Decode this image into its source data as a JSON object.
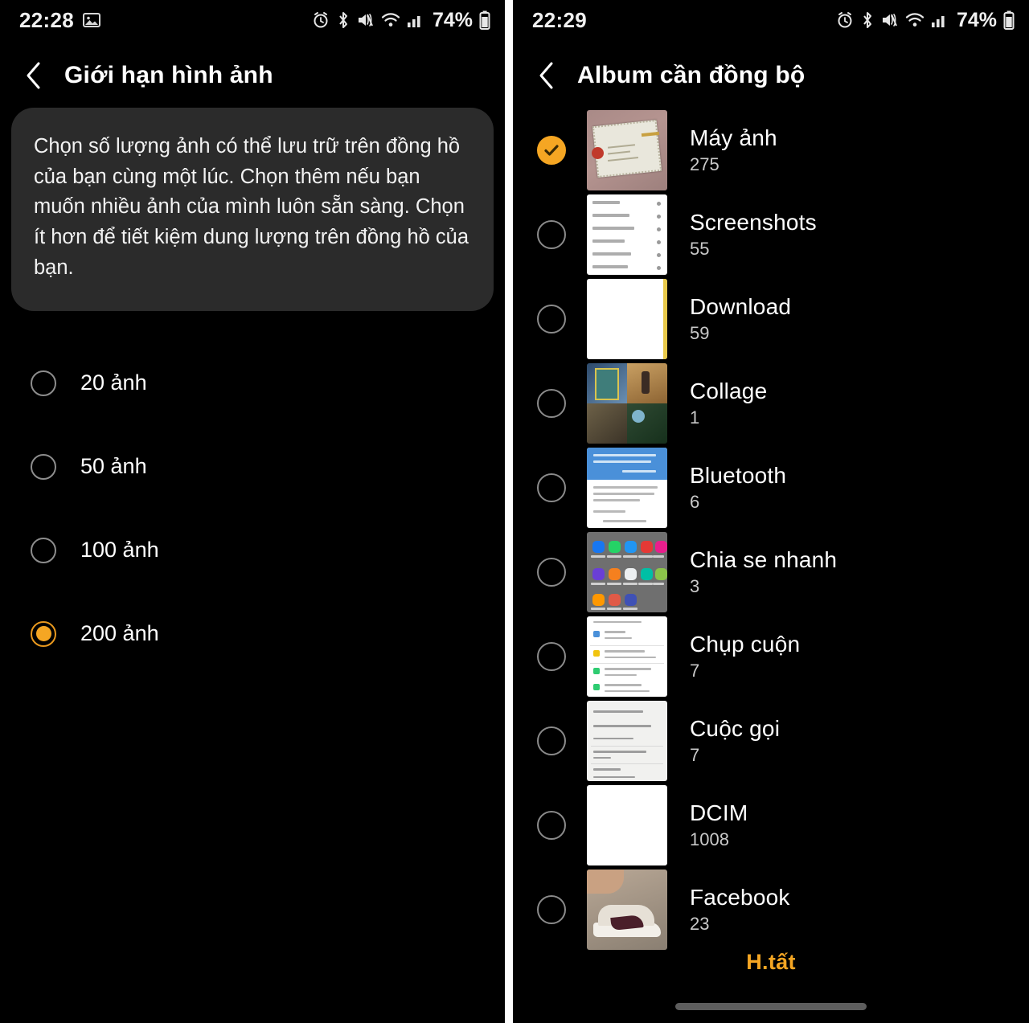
{
  "colors": {
    "accent": "#f5a623",
    "accent_ring": "#e8981e",
    "background": "#000000",
    "card": "#2b2b2b",
    "text_primary": "#ffffff",
    "text_secondary": "#c9c9c9",
    "divider": "#fdfdfd"
  },
  "left_screen": {
    "statusbar": {
      "time": "22:28",
      "battery_percent": "74%",
      "icons": [
        "image-icon",
        "alarm-icon",
        "bluetooth-icon",
        "mute-vibrate-icon",
        "wifi-icon",
        "signal-bars-icon",
        "battery-icon"
      ]
    },
    "header": {
      "back_icon": "chevron-left-icon",
      "title": "Giới hạn hình ảnh"
    },
    "description": "Chọn số lượng ảnh có thể lưu trữ trên đồng hồ của bạn cùng một lúc. Chọn thêm nếu bạn muốn nhiều ảnh của mình luôn sẵn sàng. Chọn ít hơn để tiết kiệm dung lượng trên đồng hồ của bạn.",
    "options": [
      {
        "label": "20 ảnh",
        "selected": false
      },
      {
        "label": "50 ảnh",
        "selected": false
      },
      {
        "label": "100 ảnh",
        "selected": false
      },
      {
        "label": "200 ảnh",
        "selected": true
      }
    ]
  },
  "right_screen": {
    "statusbar": {
      "time": "22:29",
      "battery_percent": "74%",
      "icons": [
        "alarm-icon",
        "bluetooth-icon",
        "mute-vibrate-icon",
        "wifi-icon",
        "signal-bars-icon",
        "battery-icon"
      ]
    },
    "header": {
      "back_icon": "chevron-left-icon",
      "title": "Album cần đồng bộ"
    },
    "albums": [
      {
        "name": "Máy ảnh",
        "count": "275",
        "checked": true,
        "thumb": "certificate-photo"
      },
      {
        "name": "Screenshots",
        "count": "55",
        "checked": false,
        "thumb": "document-screenshot"
      },
      {
        "name": "Download",
        "count": "59",
        "checked": false,
        "thumb": "blank-white-page"
      },
      {
        "name": "Collage",
        "count": "1",
        "checked": false,
        "thumb": "photo-collage"
      },
      {
        "name": "Bluetooth",
        "count": "6",
        "checked": false,
        "thumb": "chat-screenshot"
      },
      {
        "name": "Chia se nhanh",
        "count": "3",
        "checked": false,
        "thumb": "app-grid-screenshot"
      },
      {
        "name": "Chụp cuộn",
        "count": "7",
        "checked": false,
        "thumb": "notes-screenshot"
      },
      {
        "name": "Cuộc gọi",
        "count": "7",
        "checked": false,
        "thumb": "call-log-screenshot"
      },
      {
        "name": "DCIM",
        "count": "1008",
        "checked": false,
        "thumb": "blank-white-page"
      },
      {
        "name": "Facebook",
        "count": "23",
        "checked": false,
        "thumb": "sneaker-photo"
      }
    ],
    "done_button": "H.tất"
  }
}
